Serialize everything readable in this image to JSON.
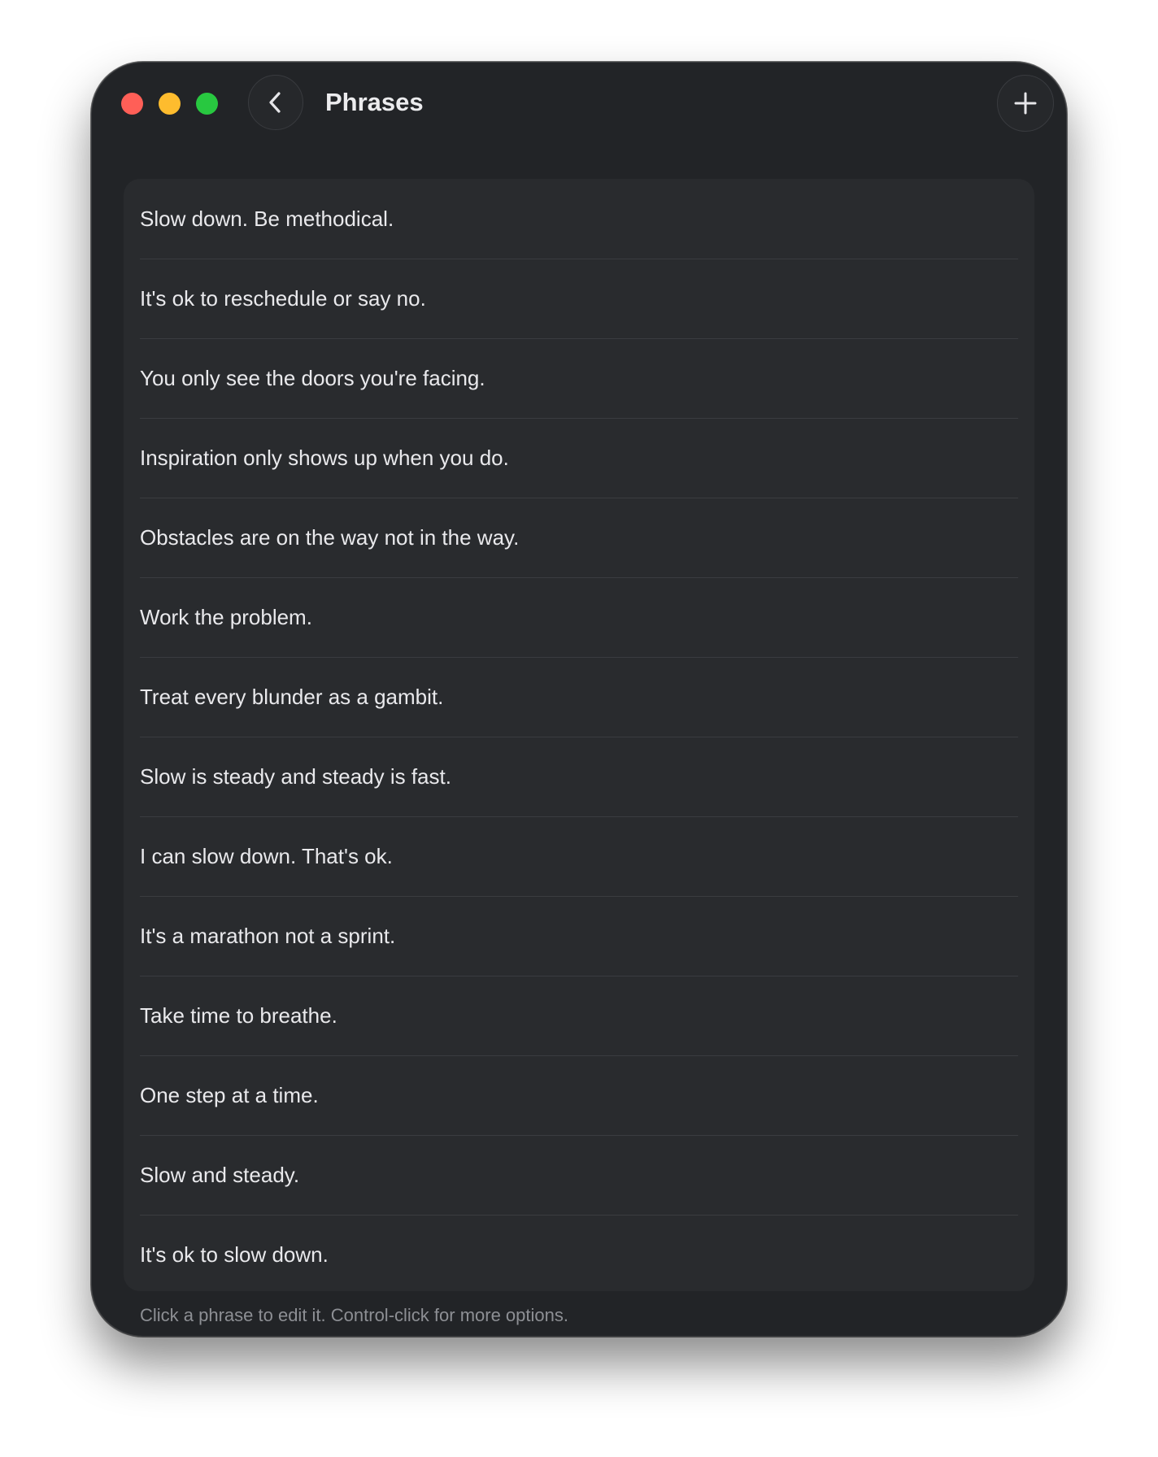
{
  "window": {
    "title": "Phrases"
  },
  "toolbar": {
    "back_icon": "chevron-left-icon",
    "add_icon": "plus-icon"
  },
  "phrases": [
    "Slow down. Be methodical.",
    "It's ok to reschedule or say no.",
    "You only see the doors you're facing.",
    "Inspiration only shows up when you do.",
    "Obstacles are on the way not in the way.",
    "Work the problem.",
    "Treat every blunder as a gambit.",
    "Slow is steady and steady is fast.",
    "I can slow down. That's ok.",
    "It's a marathon not a sprint.",
    "Take time to breathe.",
    "One step at a time.",
    "Slow and steady.",
    "It's ok to slow down."
  ],
  "footer": {
    "hint": "Click a phrase to edit it. Control-click for more options."
  },
  "colors": {
    "window_bg": "#222427",
    "card_bg": "#292b2e",
    "close": "#ff5f57",
    "minimize": "#febc2e",
    "zoom": "#28c840"
  }
}
